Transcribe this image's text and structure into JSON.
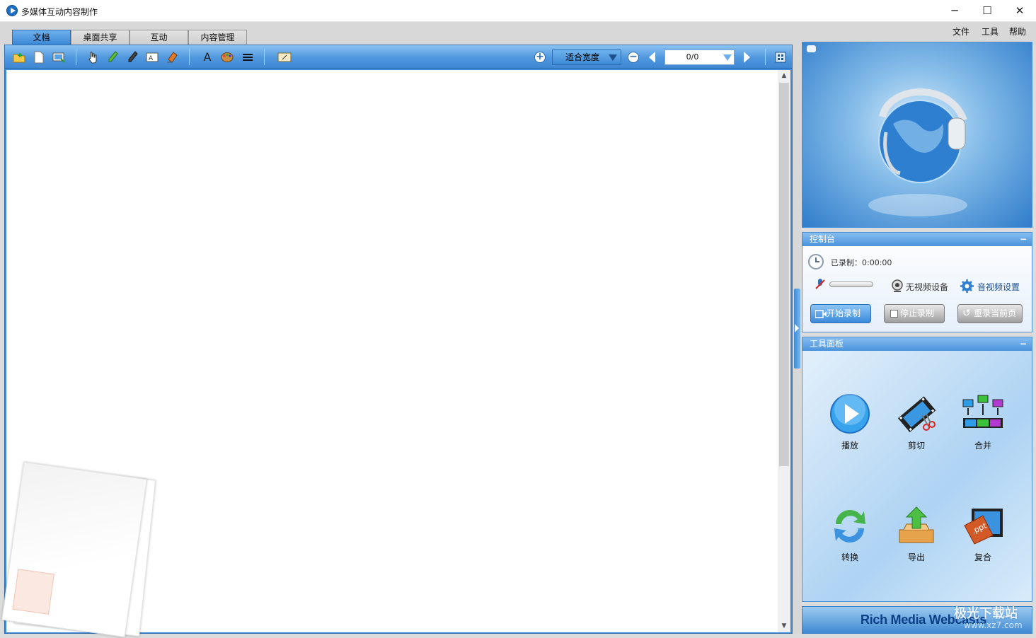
{
  "window": {
    "title": "多媒体互动内容制作",
    "controls": {
      "minimize": "─",
      "maximize": "☐",
      "close": "✕"
    }
  },
  "tabs": [
    {
      "label": "文档",
      "active": true
    },
    {
      "label": "桌面共享",
      "active": false
    },
    {
      "label": "互动",
      "active": false
    },
    {
      "label": "内容管理",
      "active": false
    }
  ],
  "menu": {
    "file": "文件",
    "tools": "工具",
    "help": "帮助"
  },
  "toolbar": {
    "zoom_value": "适合宽度",
    "page_value": "0/0"
  },
  "control_panel": {
    "title": "控制台",
    "recorded_label": "已录制：0:00:00",
    "video_device": "无视频设备",
    "av_settings": "音视频设置",
    "start_record": "开始录制",
    "stop_record": "停止录制",
    "rerecord_page": "重录当前页"
  },
  "tools_panel": {
    "title": "工具面板",
    "items": [
      {
        "label": "播放"
      },
      {
        "label": "剪切"
      },
      {
        "label": "合并"
      },
      {
        "label": "转换"
      },
      {
        "label": "导出"
      },
      {
        "label": "复合"
      }
    ]
  },
  "brand": {
    "text_a": "Rich Media ",
    "text_b": "Webcasts",
    "watermark": "极光下载站",
    "watermark_url": "www.xz7.com"
  },
  "colors": {
    "accent": "#3f8ad6",
    "header": "#4a93dc"
  }
}
